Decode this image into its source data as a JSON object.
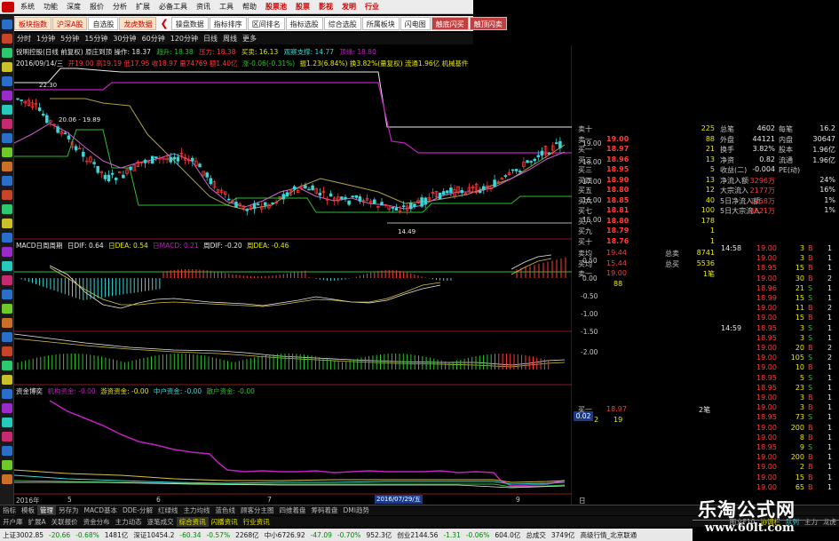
{
  "menu": [
    "系统",
    "功能",
    "深度",
    "报价",
    "分析",
    "扩展",
    "必备工具",
    "资讯",
    "工具",
    "帮助",
    "股票池",
    "股票",
    "影视",
    "发明",
    "行业"
  ],
  "tabs": [
    "板块指数",
    "沪深A股",
    "自选股",
    "龙虎数据",
    "操盘数据",
    "指标排序",
    "区间排名",
    "指标选股",
    "综合选股",
    "所属板块",
    "闪电图",
    "触底闪买",
    "触顶闪卖"
  ],
  "periods": [
    "分时",
    "1分钟",
    "5分钟",
    "15分钟",
    "30分钟",
    "60分钟",
    "120分钟",
    "日线",
    "周线",
    "更多"
  ],
  "header_line1": "锐明控股(日线 前复权) 原庄到顶 操作: 18.37",
  "header_line1_b": "趋升: 18.38",
  "header_line1_c": "压力: 18.38",
  "header_line1_d": "买卖: 16.13",
  "header_line1_e": "观察支撑: 14.77",
  "header_line1_f": "顶缘: 18.80",
  "header_line2": "2016/09/14/三",
  "header_line2_b": "开19.00 高19.19 低17.95 收18.97 量74769 额1.40亿",
  "header_line2_c": "涨-0.06(-0.31%)",
  "header_line2_d": "振1.23(6.84%) 换3.82%(量复权) 流通1.96亿 机械基件",
  "price_labels": [
    "19.00",
    "18.00",
    "17.00",
    "16.00",
    "15.00"
  ],
  "price_annotations": {
    "high": "22.30",
    "mid": "20.06 - 19.89",
    "low": "14.49"
  },
  "macd_header": "MACD日周周期",
  "macd_vals": {
    "dif": "日DIF: 0.64",
    "dea": "日DEA: 0.54",
    "macd": "日MACD: 0.21",
    "wdif": "周DIF: -0.20",
    "wdea": "周DEA: -0.46"
  },
  "macd_labels": [
    "0.50",
    "0.00",
    "-0.50",
    "-1.00",
    "-1.50",
    "-2.00"
  ],
  "fund_header": "资金博奕",
  "fund_vals": {
    "inst": "机构资金: -0.00",
    "big": "游资资金: -0.00",
    "mid": "中户资金: -0.00",
    "small": "散户资金: -0.00"
  },
  "fund_badge": "0.02",
  "date_axis": [
    "2016年",
    "5",
    "6",
    "7",
    "9"
  ],
  "date_cursor": "2016/07/29/五",
  "axis_right": "日线",
  "quote_rows": [
    {
      "label": "卖十",
      "price": "",
      "vol": "225",
      "r1": "总笔",
      "v1": "4602",
      "r2": "每笔",
      "v2": "16.2"
    },
    {
      "label": "卖一",
      "price": "19.00",
      "vol": "88",
      "r1": "外盘",
      "v1": "44121",
      "r2": "内盘",
      "v2": "30647"
    },
    {
      "label": "买一",
      "price": "18.97",
      "vol": "21",
      "r1": "换手",
      "v1": "3.82%",
      "r2": "股本",
      "v2": "1.96亿"
    },
    {
      "label": "买二",
      "price": "18.96",
      "vol": "13",
      "r1": "净资",
      "v1": "0.82",
      "r2": "流通",
      "v2": "1.96亿"
    },
    {
      "label": "买三",
      "price": "18.95",
      "vol": "5",
      "r1": "收益(二)",
      "v1": "-0.004",
      "r2": "PE(动)",
      "v2": ""
    },
    {
      "label": "买四",
      "price": "18.90",
      "vol": "13",
      "r1": "净流入额",
      "v1": "3296万",
      "r2": "",
      "v2": "24%"
    },
    {
      "label": "买五",
      "price": "18.80",
      "vol": "12",
      "r1": "大宗流入",
      "v1": "2177万",
      "r2": "",
      "v2": "16%"
    },
    {
      "label": "买六",
      "price": "18.85",
      "vol": "40",
      "r1": "5日净流入额",
      "v1": "1758万",
      "r2": "",
      "v2": "1%"
    },
    {
      "label": "买七",
      "price": "18.81",
      "vol": "100",
      "r1": "5日大宗流入",
      "v1": "4621万",
      "r2": "",
      "v2": "1%"
    },
    {
      "label": "买八",
      "price": "18.80",
      "vol": "178",
      "r1": "",
      "v1": "",
      "r2": "",
      "v2": ""
    },
    {
      "label": "买九",
      "price": "18.79",
      "vol": "1",
      "r1": "",
      "v1": "",
      "r2": "",
      "v2": ""
    },
    {
      "label": "买十",
      "price": "18.76",
      "vol": "1",
      "r1": "",
      "v1": "",
      "r2": "",
      "v2": ""
    }
  ],
  "avg_rows": [
    {
      "l": "卖均",
      "p": "19.44",
      "l2": "总卖",
      "v": "8741"
    },
    {
      "l": "买均",
      "p": "15.44",
      "l2": "总买",
      "v": "5536"
    },
    {
      "l": "卖一",
      "p": "19.00",
      "l2": "",
      "v": "1笔"
    }
  ],
  "sell_one_vol": "88",
  "buy_one_row": {
    "l": "买一",
    "p": "18.97",
    "v": "2笔"
  },
  "buy_one_sub": [
    "2",
    "19"
  ],
  "ticks": [
    {
      "time": "14:58",
      "price": "19.00",
      "vol": "3",
      "dir": "B",
      "n": "1"
    },
    {
      "time": "",
      "price": "19.00",
      "vol": "3",
      "dir": "B",
      "n": "1"
    },
    {
      "time": "",
      "price": "18.95",
      "vol": "15",
      "dir": "B",
      "n": "1"
    },
    {
      "time": "",
      "price": "19.00",
      "vol": "30",
      "dir": "B",
      "n": "2"
    },
    {
      "time": "",
      "price": "18.96",
      "vol": "21",
      "dir": "S",
      "n": "1"
    },
    {
      "time": "",
      "price": "18.99",
      "vol": "15",
      "dir": "S",
      "n": "1"
    },
    {
      "time": "",
      "price": "19.00",
      "vol": "11",
      "dir": "B",
      "n": "2"
    },
    {
      "time": "",
      "price": "19.00",
      "vol": "15",
      "dir": "B",
      "n": "1"
    },
    {
      "time": "14:59",
      "price": "18.95",
      "vol": "3",
      "dir": "S",
      "n": "1"
    },
    {
      "time": "",
      "price": "18.95",
      "vol": "3",
      "dir": "S",
      "n": "1"
    },
    {
      "time": "",
      "price": "19.00",
      "vol": "20",
      "dir": "B",
      "n": "2"
    },
    {
      "time": "",
      "price": "19.00",
      "vol": "105",
      "dir": "S",
      "n": "2"
    },
    {
      "time": "",
      "price": "19.00",
      "vol": "10",
      "dir": "B",
      "n": "1"
    },
    {
      "time": "",
      "price": "18.95",
      "vol": "5",
      "dir": "S",
      "n": "1"
    },
    {
      "time": "",
      "price": "18.95",
      "vol": "23",
      "dir": "S",
      "n": "1"
    },
    {
      "time": "",
      "price": "19.00",
      "vol": "3",
      "dir": "B",
      "n": "1"
    },
    {
      "time": "",
      "price": "19.00",
      "vol": "3",
      "dir": "B",
      "n": "1"
    },
    {
      "time": "",
      "price": "18.95",
      "vol": "73",
      "dir": "S",
      "n": "1"
    },
    {
      "time": "",
      "price": "19.00",
      "vol": "200",
      "dir": "B",
      "n": "1"
    },
    {
      "time": "",
      "price": "19.00",
      "vol": "8",
      "dir": "B",
      "n": "1"
    },
    {
      "time": "",
      "price": "18.95",
      "vol": "9",
      "dir": "S",
      "n": "1"
    },
    {
      "time": "",
      "price": "19.00",
      "vol": "200",
      "dir": "B",
      "n": "1"
    },
    {
      "time": "",
      "price": "19.00",
      "vol": "2",
      "dir": "B",
      "n": "1"
    },
    {
      "time": "",
      "price": "19.00",
      "vol": "15",
      "dir": "B",
      "n": "1"
    },
    {
      "time": "",
      "price": "19.00",
      "vol": "65",
      "dir": "B",
      "n": "1"
    }
  ],
  "bottom_tabs": [
    "指标",
    "模板",
    "管理",
    "另存为",
    "MACD基本",
    "DDE-分解",
    "红绿线",
    "主力均线",
    "蓝色线",
    "顾客分主图",
    "四维着盘",
    "筹码着盘",
    "DMI趋势"
  ],
  "bottom_tabs2": [
    "开户庫",
    "扩展A",
    "关联报价",
    "资金分布",
    "主力动态",
    "逐笔成交",
    "综合资讯",
    "闪播资讯",
    "行业资讯"
  ],
  "bottom_right": [
    "图文F10",
    "协调栏",
    "队列",
    "主力",
    "龙虎"
  ],
  "status": [
    "上证3002.85",
    "-20.66",
    "-0.68%",
    "1481亿",
    "深证10454.2",
    "-60.34",
    "-0.57%",
    "2268亿",
    "中小6726.92",
    "-47.09",
    "-0.70%",
    "952.3亿",
    "创业2144.56",
    "-1.31",
    "-0.06%",
    "604.0亿",
    "总成交",
    "3749亿",
    "高级行情_北京联通"
  ],
  "watermark": {
    "cn": "乐淘公式网",
    "url": "www.60lt.com"
  },
  "colors": {
    "up": "#ff3b3b",
    "down": "#3ad7d7",
    "yellow": "#e8e800",
    "magenta": "#c020c0",
    "green": "#30c030"
  }
}
